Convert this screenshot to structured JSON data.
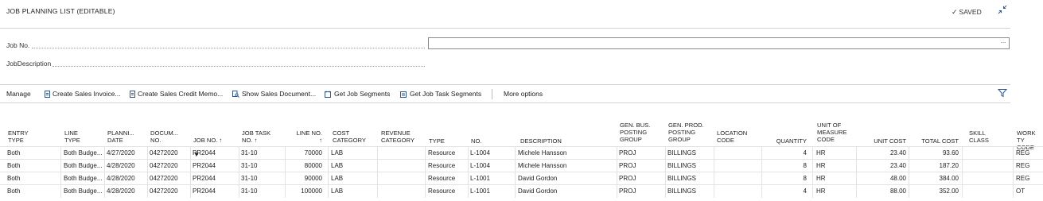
{
  "header": {
    "title": "JOB PLANNING LIST (EDITABLE)",
    "saved_label": "SAVED"
  },
  "fields": {
    "job_no_label": "Job No.",
    "job_no_value": "",
    "job_no_more": "···",
    "job_description_label": "JobDescription",
    "job_description_value": ""
  },
  "actions": {
    "manage": "Manage",
    "create_sales_invoice": "Create Sales Invoice...",
    "create_sales_credit_memo": "Create Sales Credit Memo...",
    "show_sales_document": "Show Sales Document...",
    "get_job_segments": "Get Job Segments",
    "get_job_task_segments": "Get Job Task Segments",
    "more_options": "More options"
  },
  "columns": {
    "entry_type": "ENTRY\nTYPE",
    "line_type": "LINE\nTYPE",
    "planning_date": "PLANNI...\nDATE",
    "document_no": "DOCUM...\nNO.",
    "job_no": "JOB NO. ↑",
    "job_task_no": "JOB TASK\nNO. ↑",
    "line_no": "LINE NO.\n↑",
    "cost_category": "COST\nCATEGORY",
    "revenue_category": "REVENUE\nCATEGORY",
    "type": "TYPE",
    "no": "NO.",
    "description": "DESCRIPTION",
    "gen_bus_posting_group": "GEN. BUS.\nPOSTING\nGROUP",
    "gen_prod_posting_group": "GEN. PROD.\nPOSTING\nGROUP",
    "location_code": "LOCATION\nCODE",
    "quantity": "QUANTITY",
    "unit_of_measure_code": "UNIT OF\nMEASURE\nCODE",
    "unit_cost": "UNIT COST",
    "total_cost": "TOTAL COST",
    "skill_class": "SKILL\nCLASS",
    "work_type_code": "WORK TY\nCODE"
  },
  "rows": [
    {
      "entry_type": "Both",
      "line_type": "Both Budge...",
      "planning_date": "4/27/2020",
      "document_no": "04272020",
      "job_no": "PR2044",
      "job_task_no": "31-10",
      "line_no": "70000",
      "cost_category": "LAB",
      "revenue_category": "",
      "type": "Resource",
      "no": "L-1004",
      "description": "Michele Hansson",
      "gen_bus": "PROJ",
      "gen_prod": "BILLINGS",
      "location": "",
      "quantity": "4",
      "uom": "HR",
      "unit_cost": "23.40",
      "total_cost": "93.60",
      "skill_class": "",
      "work_type": "REG"
    },
    {
      "entry_type": "Both",
      "line_type": "Both Budge...",
      "planning_date": "4/28/2020",
      "document_no": "04272020",
      "job_no": "PR2044",
      "job_task_no": "31-10",
      "line_no": "80000",
      "cost_category": "LAB",
      "revenue_category": "",
      "type": "Resource",
      "no": "L-1004",
      "description": "Michele Hansson",
      "gen_bus": "PROJ",
      "gen_prod": "BILLINGS",
      "location": "",
      "quantity": "8",
      "uom": "HR",
      "unit_cost": "23.40",
      "total_cost": "187.20",
      "skill_class": "",
      "work_type": "REG"
    },
    {
      "entry_type": "Both",
      "line_type": "Both Budge...",
      "planning_date": "4/28/2020",
      "document_no": "04272020",
      "job_no": "PR2044",
      "job_task_no": "31-10",
      "line_no": "90000",
      "cost_category": "LAB",
      "revenue_category": "",
      "type": "Resource",
      "no": "L-1001",
      "description": "David Gordon",
      "gen_bus": "PROJ",
      "gen_prod": "BILLINGS",
      "location": "",
      "quantity": "8",
      "uom": "HR",
      "unit_cost": "48.00",
      "total_cost": "384.00",
      "skill_class": "",
      "work_type": "REG"
    },
    {
      "entry_type": "Both",
      "line_type": "Both Budge...",
      "planning_date": "4/28/2020",
      "document_no": "04272020",
      "job_no": "PR2044",
      "job_task_no": "31-10",
      "line_no": "100000",
      "cost_category": "LAB",
      "revenue_category": "",
      "type": "Resource",
      "no": "L-1001",
      "description": "David Gordon",
      "gen_bus": "PROJ",
      "gen_prod": "BILLINGS",
      "location": "",
      "quantity": "4",
      "uom": "HR",
      "unit_cost": "88.00",
      "total_cost": "352.00",
      "skill_class": "",
      "work_type": "OT"
    }
  ],
  "colors": {
    "accent": "#2b5797",
    "divider": "#d2d2d2"
  }
}
